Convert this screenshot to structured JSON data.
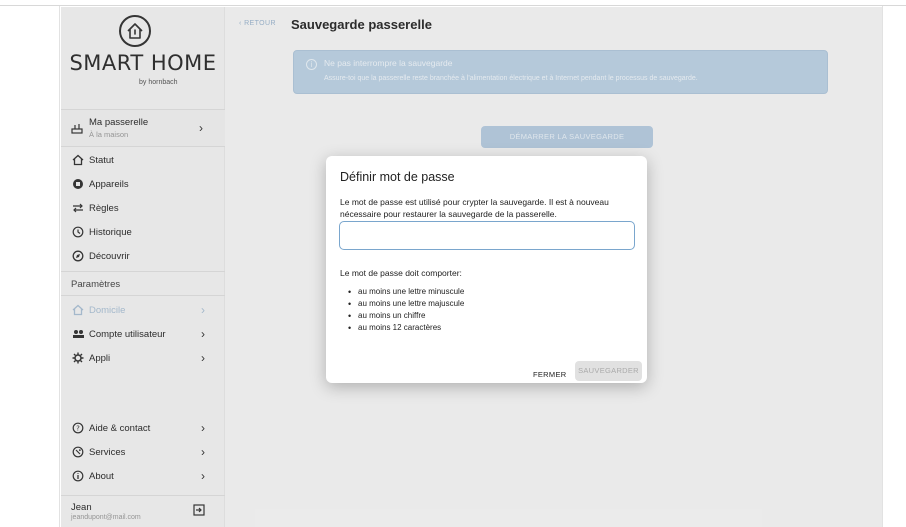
{
  "brand": {
    "title": "SMART HOME",
    "subtitle": "by hornbach"
  },
  "gateway": {
    "title": "Ma passerelle",
    "subtitle": "À la maison"
  },
  "nav": {
    "statut": "Statut",
    "appareils": "Appareils",
    "regles": "Règles",
    "historique": "Historique",
    "decouvrir": "Découvrir"
  },
  "settings": {
    "label": "Paramètres",
    "domicile": "Domicile",
    "compte": "Compte utilisateur",
    "appli": "Appli"
  },
  "support": {
    "aide": "Aide & contact",
    "services": "Services",
    "about": "About"
  },
  "user": {
    "name": "Jean",
    "email": "jeandupont@mail.com"
  },
  "header": {
    "back": "RETOUR",
    "title": "Sauvegarde passerelle"
  },
  "info": {
    "title": "Ne pas interrompre la sauvegarde",
    "text": "Assure-toi que la passerelle reste branchée à l'alimentation électrique et à Internet pendant le processus de sauvegarde."
  },
  "start_button": "DÉMARRER LA SAUVEGARDE",
  "dialog": {
    "title": "Définir mot de passe",
    "text": "Le mot de passe est utilisé pour crypter la sauvegarde. Il est à nouveau nécessaire pour restaurer la sauvegarde de la passerelle.",
    "input_value": "",
    "requirements_label": "Le mot de passe doit comporter:",
    "requirements": [
      "au moins une lettre minuscule",
      "au moins une lettre majuscule",
      "au moins un chiffre",
      "au moins 12 caractères"
    ],
    "close_label": "FERMER",
    "save_label": "SAUVEGARDER"
  },
  "colors": {
    "accent_muted": "#b5cadf",
    "info_bg": "#bcd1e3",
    "input_border": "#7aa6cd"
  }
}
